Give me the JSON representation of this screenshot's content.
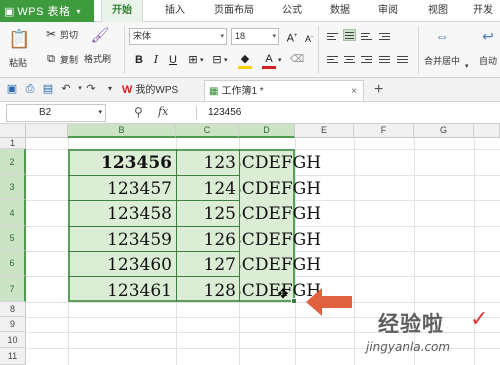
{
  "app": {
    "title": "WPS 表格",
    "logo_icon": "wps-logo-icon"
  },
  "menu": {
    "tabs": [
      "开始",
      "插入",
      "页面布局",
      "公式",
      "数据",
      "审阅",
      "视图",
      "开发"
    ],
    "active": "开始"
  },
  "ribbon": {
    "paste_label": "粘贴",
    "cut_label": "剪切",
    "copy_label": "复制",
    "format_painter_label": "格式刷",
    "font_name": "宋体",
    "font_size": "18",
    "bold_label": "B",
    "italic_label": "I",
    "underline_label": "U",
    "font_color_letter": "A",
    "grow_font_label": "A",
    "shrink_font_label": "A",
    "merge_center_label": "合并居中",
    "wrap_label": "自动",
    "font_color": "#d42020",
    "fill_color": "#f5d100"
  },
  "doc_tabs": [
    {
      "label": "我的WPS"
    },
    {
      "label": "工作簿1 *"
    }
  ],
  "formula_bar": {
    "cell_ref": "B2",
    "fx_label": "fx",
    "value": "123456"
  },
  "columns": [
    "B",
    "C",
    "D",
    "E",
    "F",
    "G"
  ],
  "rows": [
    "1",
    "2",
    "3",
    "4",
    "5",
    "6",
    "7",
    "8",
    "9",
    "10",
    "11"
  ],
  "cells": [
    {
      "b": "123456",
      "c": "123",
      "d": "BCDEFGH"
    },
    {
      "b": "123457",
      "c": "124",
      "d": "BCDEFGH"
    },
    {
      "b": "123458",
      "c": "125",
      "d": "BCDEFGH"
    },
    {
      "b": "123459",
      "c": "126",
      "d": "BCDEFGH"
    },
    {
      "b": "123460",
      "c": "127",
      "d": "BCDEFGH"
    },
    {
      "b": "123461",
      "c": "128",
      "d": "BCDEFGH"
    }
  ],
  "watermark": {
    "main": "经验啦",
    "url": "jingyanla.com",
    "check": "✓"
  },
  "colors": {
    "accent": "#3d9a3d",
    "selection_fill": "#dcedd5",
    "arrow": "#e0613f"
  }
}
